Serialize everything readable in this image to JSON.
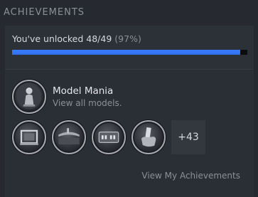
{
  "header": {
    "title": "ACHIEVEMENTS"
  },
  "progress": {
    "text": "You've unlocked 48/49",
    "percent_text": "(97%)",
    "fraction": 0.97,
    "bar_color": "#3a7cff"
  },
  "featured": {
    "icon": "model-figure-icon",
    "title": "Model Mania",
    "subtitle": "View all models."
  },
  "achievements": [
    {
      "icon": "picture-frame-icon"
    },
    {
      "icon": "submarine-icon"
    },
    {
      "icon": "digital-clock-icon"
    },
    {
      "icon": "hand-card-icon"
    }
  ],
  "more": {
    "label": "+43"
  },
  "footer": {
    "link_label": "View My Achievements"
  },
  "colors": {
    "background": "#262a30",
    "muted_text": "#8a9099",
    "primary_text": "#e4e6ea"
  }
}
